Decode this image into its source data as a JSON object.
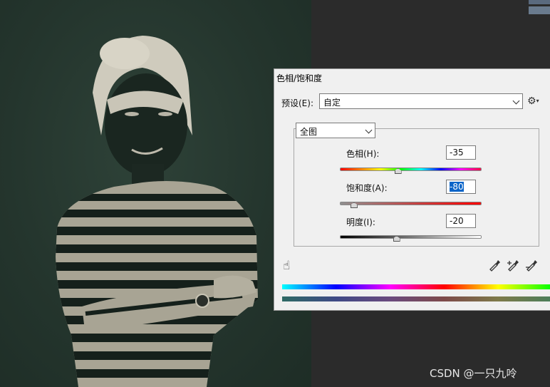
{
  "dialog": {
    "title": "色相/饱和度",
    "preset_label": "预设(E):",
    "preset_value": "自定",
    "channel_value": "全图",
    "hue": {
      "label": "色相(H):",
      "value": "-35",
      "level": 0.41
    },
    "saturation": {
      "label": "饱和度(A):",
      "value": "-80",
      "level": 0.1
    },
    "lightness": {
      "label": "明度(I):",
      "value": "-20",
      "level": 0.4
    }
  },
  "watermark": "CSDN @一只九呤",
  "icons": [
    "gear-icon",
    "hand-adjust-icon",
    "eyedropper-icon",
    "eyedropper-plus-icon",
    "eyedropper-minus-icon"
  ],
  "colors": {
    "canvas_bg": "#24352d",
    "dialog_bg": "#f0f0f0",
    "selection": "#0a64c8"
  }
}
